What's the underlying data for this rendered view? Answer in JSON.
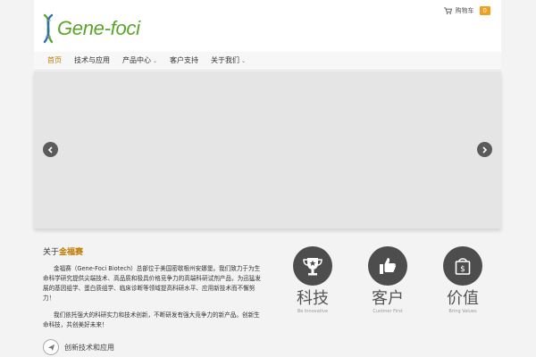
{
  "header": {
    "logo_text": "Gene-foci",
    "cart_label": "购物车",
    "cart_count": "0"
  },
  "nav": {
    "items": [
      {
        "label": "首页"
      },
      {
        "label": "技术与应用"
      },
      {
        "label": "产品中心"
      },
      {
        "label": "客户支持"
      },
      {
        "label": "关于我们"
      }
    ]
  },
  "slider": {
    "prev_icon": "chevron-left-icon",
    "next_icon": "chevron-right-icon"
  },
  "about": {
    "title_prefix": "关于",
    "title_highlight": "金福赛",
    "paragraph1": "金福赛（Gene-Foci Biotech）总部位于美国密歇根州安娜堡。我们致力于为生命科学研究提供尖端技术、高品质和极具价格竞争力的高端科研试剂产品，为迅猛发展的基因组学、蛋白质组学、临床诊断等领域提高科研水平、应用新技术而不懈努力！",
    "paragraph2": "我们依托强大的科研实力和技术创新，不断研发有强大竞争力的新产品。创新生命科技，共创美好未来！"
  },
  "values": [
    {
      "title": "科技",
      "subtitle": "Be Innovative",
      "icon": "trophy-icon"
    },
    {
      "title": "客户",
      "subtitle": "Custmer First",
      "icon": "thumbs-up-icon"
    },
    {
      "title": "价值",
      "subtitle": "Bring Values",
      "icon": "shopping-bag-icon"
    }
  ],
  "bottom": {
    "label": "创新技术和应用",
    "icon": "paper-plane-icon"
  },
  "colors": {
    "accent": "#c07a00",
    "logo_green": "#5aa52a",
    "badge": "#f0a020",
    "circle": "#4d4d4d"
  }
}
